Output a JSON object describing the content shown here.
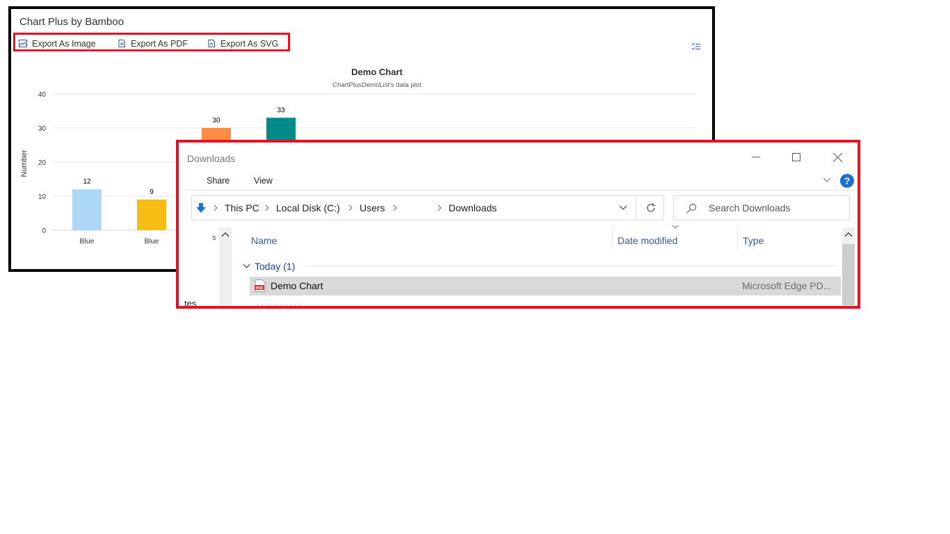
{
  "chart_panel": {
    "title": "Chart Plus by Bamboo",
    "export_buttons": [
      {
        "label": "Export As Image",
        "icon": "image-icon"
      },
      {
        "label": "Export As PDF",
        "icon": "pdf-document-icon"
      },
      {
        "label": "Export As SVG",
        "icon": "svg-document-icon"
      }
    ],
    "options_icon": "list-options-icon"
  },
  "chart_data": {
    "type": "bar",
    "title": "Demo Chart",
    "subtitle": "ChartPlusDemoList's data plot",
    "xlabel": "",
    "ylabel": "Number",
    "ylim": [
      0,
      40
    ],
    "yticks": [
      0,
      10,
      20,
      30,
      40
    ],
    "grid": true,
    "bars": [
      {
        "category": "Blue",
        "value": 12,
        "color": "#aed6f5"
      },
      {
        "category": "Blue",
        "value": 9,
        "color": "#f6bd16"
      },
      {
        "category": "",
        "value": 30,
        "color": "#ff8c42"
      },
      {
        "category": "",
        "value": 33,
        "color": "#008b8b"
      }
    ]
  },
  "explorer": {
    "title": "Downloads",
    "controls": {
      "minimize": "minimize-icon",
      "maximize": "maximize-icon",
      "close": "close-icon"
    },
    "ribbon": {
      "share": "Share",
      "view": "View"
    },
    "address": {
      "segments": [
        "This PC",
        "Local Disk (C:)",
        "Users",
        "",
        "Downloads"
      ]
    },
    "search_placeholder": "Search Downloads",
    "columns": [
      "Name",
      "Date modified",
      "Type"
    ],
    "group": "Today (1)",
    "files": [
      {
        "name": "Demo Chart",
        "type": "Microsoft Edge PD..."
      }
    ]
  },
  "colors": {
    "highlight_border": "#e81123",
    "panel_border": "#000000",
    "selected_row": "#d9d9d9",
    "link_blue": "#1e3d8f"
  }
}
